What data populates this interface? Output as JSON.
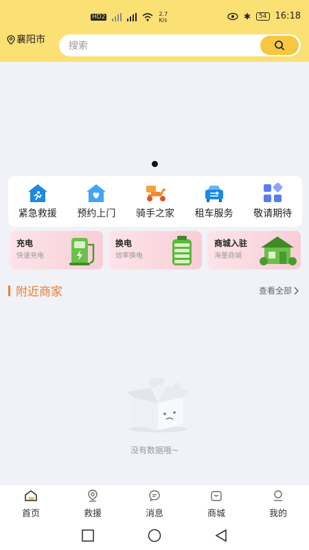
{
  "status": {
    "network_speed": "2.7",
    "network_unit": "K/s",
    "battery": "54",
    "time": "16:18",
    "hd_label": "HD",
    "sim_num": "2"
  },
  "header": {
    "city": "襄阳市",
    "search_placeholder": "搜索"
  },
  "services": [
    {
      "label": "紧急救援",
      "icon": "rescue-icon",
      "color": "#1e88e5"
    },
    {
      "label": "预约上门",
      "icon": "home-heart-icon",
      "color": "#3fa7f5"
    },
    {
      "label": "骑手之家",
      "icon": "scooter-icon",
      "color": "#f08a2a"
    },
    {
      "label": "租车服务",
      "icon": "car-rental-icon",
      "color": "#2196f3"
    },
    {
      "label": "敬请期待",
      "icon": "apps-icon",
      "color": "#5b7bf0"
    }
  ],
  "promos": [
    {
      "title": "充电",
      "subtitle": "快速充电",
      "icon": "charging-pile-icon"
    },
    {
      "title": "换电",
      "subtitle": "效率换电",
      "icon": "battery-icon"
    },
    {
      "title": "商城入驻",
      "subtitle": "海量商城",
      "icon": "shop-house-icon"
    }
  ],
  "nearby": {
    "title": "附近商家",
    "view_all": "查看全部",
    "empty_text": "没有数据哦~"
  },
  "tabs": [
    {
      "label": "首页",
      "icon": "home-icon"
    },
    {
      "label": "救援",
      "icon": "location-icon"
    },
    {
      "label": "消息",
      "icon": "message-icon"
    },
    {
      "label": "商城",
      "icon": "bag-icon"
    },
    {
      "label": "我的",
      "icon": "profile-icon"
    }
  ],
  "colors": {
    "header_bg": "#fbe074",
    "search_button": "#f7c742",
    "accent_orange": "#f07a2a",
    "page_bg": "#f0f2f8"
  }
}
